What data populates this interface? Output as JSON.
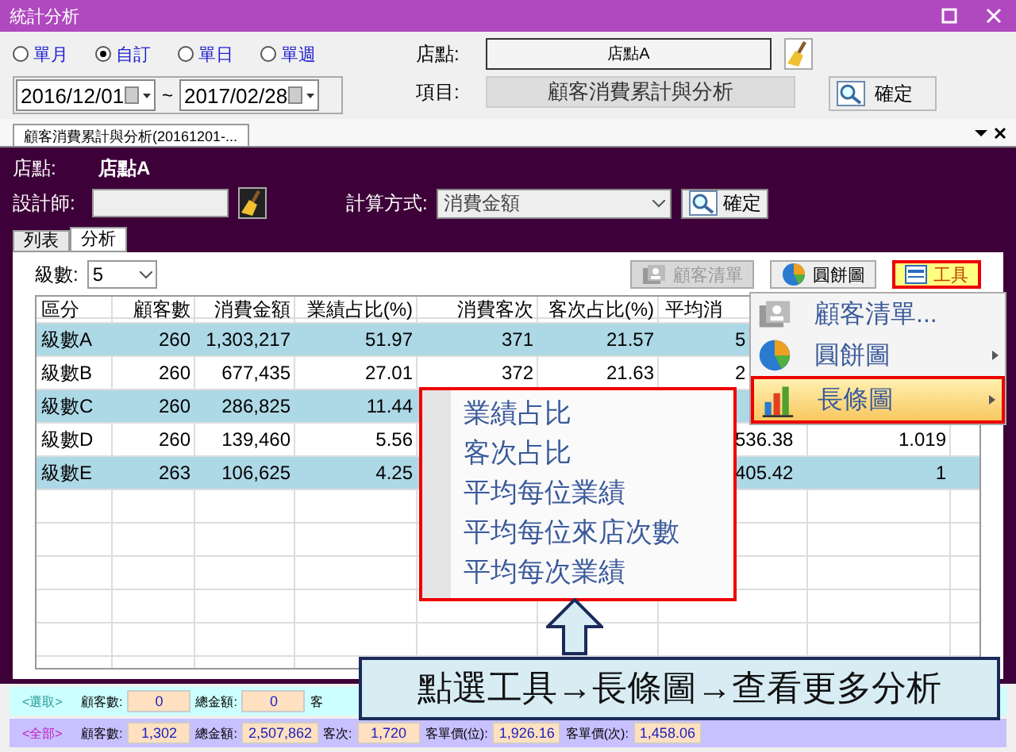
{
  "window": {
    "title": "統計分析"
  },
  "period_options": [
    {
      "label": "單月",
      "selected": false
    },
    {
      "label": "自訂",
      "selected": true
    },
    {
      "label": "單日",
      "selected": false
    },
    {
      "label": "單週",
      "selected": false
    }
  ],
  "date_from": "2016/12/01",
  "date_separator": "~",
  "date_to": "2017/02/28",
  "store": {
    "label": "店點:",
    "value": "店點A"
  },
  "item": {
    "label": "項目:",
    "value": "顧客消費累計與分析"
  },
  "confirm_button": "確定",
  "document_tab": {
    "title": "顧客消費累計與分析(20161201-..."
  },
  "panel": {
    "store_label": "店點:",
    "store_value": "店點A",
    "designer_label": "設計師:",
    "calc_label": "計算方式:",
    "calc_value": "消費金額",
    "confirm_button": "確定"
  },
  "view_tabs": [
    {
      "label": "列表",
      "selected": false
    },
    {
      "label": "分析",
      "selected": true
    }
  ],
  "levels": {
    "label": "級數:",
    "value": "5"
  },
  "toolbar_buttons": [
    {
      "label": "顧客清單",
      "kind": "list",
      "disabled": true,
      "highlighted": false
    },
    {
      "label": "圓餅圖",
      "kind": "pie",
      "disabled": false,
      "highlighted": false
    },
    {
      "label": "工具",
      "kind": "tools",
      "disabled": false,
      "highlighted": true
    }
  ],
  "table": {
    "columns": [
      "區分",
      "顧客數",
      "消費金額",
      "業績占比(%)",
      "消費客次",
      "客次占比(%)",
      "平均消",
      null,
      null
    ],
    "rows": [
      [
        "級數A",
        "260",
        "1,303,217",
        "51.97",
        "371",
        "21.57",
        "5",
        null,
        null
      ],
      [
        "級數B",
        "260",
        "677,435",
        "27.01",
        "372",
        "21.63",
        "2",
        null,
        null
      ],
      [
        "級數C",
        "260",
        "286,825",
        "11.44",
        null,
        null,
        null,
        null,
        null
      ],
      [
        "級數D",
        "260",
        "139,460",
        "5.56",
        null,
        null,
        "536.38",
        "1.019",
        null
      ],
      [
        "級數E",
        "263",
        "106,625",
        "4.25",
        null,
        null,
        "405.42",
        "1",
        null
      ]
    ]
  },
  "tools_menu": [
    {
      "label": "顧客清單...",
      "kind": "list",
      "submenu": false,
      "highlighted": false
    },
    {
      "label": "圓餅圖",
      "kind": "pie",
      "submenu": true,
      "highlighted": false
    },
    {
      "label": "長條圖",
      "kind": "bar",
      "submenu": true,
      "highlighted": true
    }
  ],
  "bar_submenu": [
    "業績占比",
    "客次占比",
    "平均每位業績",
    "平均每位來店次數",
    "平均每次業績"
  ],
  "callout": "點選工具→長條圖→查看更多分析",
  "summary_selected": {
    "label": "<選取>",
    "fields": [
      {
        "label": "顧客數:",
        "value": "0"
      },
      {
        "label": "總金額:",
        "value": "0"
      },
      {
        "label": "客"
      }
    ]
  },
  "summary_all": {
    "label": "<全部>",
    "fields": [
      {
        "label": "顧客數:",
        "value": "1,302"
      },
      {
        "label": "總金額:",
        "value": "2,507,862"
      },
      {
        "label": "客次:",
        "value": "1,720"
      },
      {
        "label": "客單價(位):",
        "value": "1,926.16"
      },
      {
        "label": "客單價(次):",
        "value": "1,458.06"
      }
    ]
  }
}
